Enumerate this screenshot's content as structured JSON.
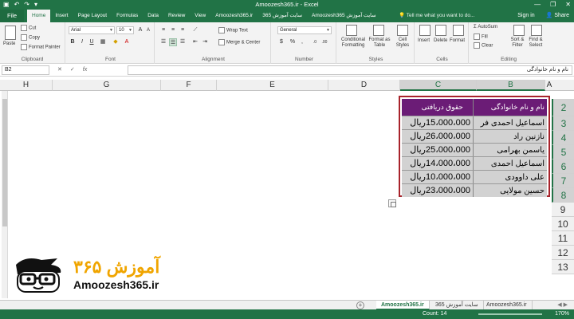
{
  "window": {
    "title": "Amoozesh365.ir - Excel",
    "controls": [
      "—",
      "❐",
      "✕"
    ]
  },
  "ribbon_tabs": {
    "file": "File",
    "tabs": [
      "Home",
      "Insert",
      "Page Layout",
      "Formulas",
      "Data",
      "Review",
      "View",
      "Amoozesh365.ir",
      "سایت آموزش 365",
      "Amoozesh365 سایت آموزش"
    ],
    "active": "Home",
    "tell_me": "Tell me what you want to do...",
    "sign_in": "Sign in",
    "share": "Share"
  },
  "ribbon": {
    "clipboard": {
      "label": "Clipboard",
      "paste": "Paste",
      "cut": "Cut",
      "copy": "Copy",
      "format_painter": "Format Painter"
    },
    "font": {
      "label": "Font",
      "name": "Arial",
      "size": "10",
      "bold": "B",
      "italic": "I",
      "underline": "U"
    },
    "alignment": {
      "label": "Alignment",
      "wrap_text": "Wrap Text",
      "merge_center": "Merge & Center"
    },
    "number": {
      "label": "Number",
      "format": "General",
      "currency": "$",
      "percent": "%",
      "comma": ","
    },
    "styles": {
      "label": "Styles",
      "conditional": "Conditional Formatting",
      "format_table": "Format as Table",
      "cell_styles": "Cell Styles"
    },
    "cells": {
      "label": "Cells",
      "insert": "Insert",
      "delete": "Delete",
      "format": "Format"
    },
    "editing": {
      "label": "Editing",
      "autosum": "AutoSum",
      "fill": "Fill",
      "clear": "Clear",
      "sort_filter": "Sort & Filter",
      "find_select": "Find & Select"
    }
  },
  "formula_bar": {
    "name_box": "B2",
    "cancel": "✕",
    "enter": "✓",
    "fx": "fx",
    "content": "نام و نام خانوادگی"
  },
  "columns": [
    "H",
    "G",
    "F",
    "E",
    "D",
    "C",
    "B",
    "A"
  ],
  "selected_columns": [
    "C",
    "B"
  ],
  "rows": [
    "2",
    "3",
    "4",
    "5",
    "6",
    "7",
    "8",
    "9",
    "10",
    "11",
    "12",
    "13"
  ],
  "selected_rows": [
    "2",
    "3",
    "4",
    "5",
    "6",
    "7",
    "8"
  ],
  "table": {
    "header": {
      "b": "نام و نام خانوادگی",
      "c": "حقوق دریافتی"
    },
    "rows": [
      {
        "b": "اسماعیل احمدی فر",
        "c": "15،000،000ریال"
      },
      {
        "b": "نازنین راد",
        "c": "26،000،000ریال"
      },
      {
        "b": "یاسمن بهرامی",
        "c": "25،000،000ریال"
      },
      {
        "b": "اسماعیل احمدی",
        "c": "14،000،000ریال"
      },
      {
        "b": "علی داوودی",
        "c": "10،000،000ریال"
      },
      {
        "b": "حسین مولایی",
        "c": "23،000،000ریال"
      }
    ],
    "header_color": "#6b1c76",
    "border_color": "#a8232b"
  },
  "logo": {
    "persian": "آموزش ۳۶۵",
    "english": "Amoozesh365.ir"
  },
  "sheets": {
    "tabs": [
      "Amoozesh365.ir",
      "سایت آموزش 365",
      "Amoozesh365.ir"
    ],
    "active": 0
  },
  "status": {
    "ready": "",
    "count": "Count: 14",
    "zoom": "170%"
  },
  "colors": {
    "accent": "#217346"
  }
}
